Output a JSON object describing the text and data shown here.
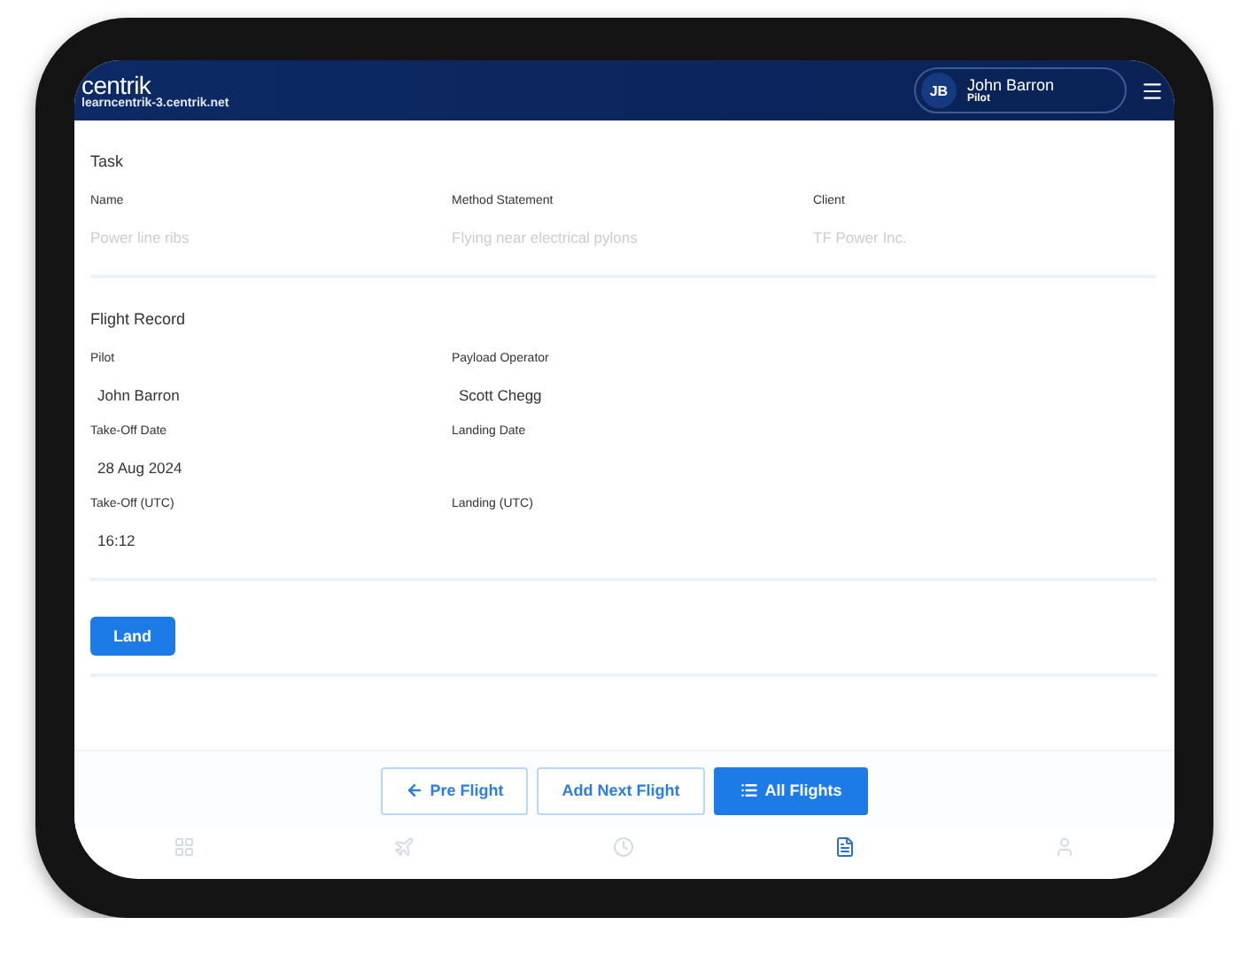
{
  "header": {
    "logo": "centrik",
    "url": "learncentrik-3.centrik.net",
    "user": {
      "initials": "JB",
      "name": "John Barron",
      "role": "Pilot"
    }
  },
  "sections": [
    {
      "title": "Task",
      "rows": [
        [
          {
            "label": "Name",
            "value": "Power line ribs",
            "disabled": true
          },
          {
            "label": "Method Statement",
            "value": "Flying near electrical pylons",
            "disabled": true
          },
          {
            "label": "Client",
            "value": "TF Power Inc.",
            "disabled": true
          }
        ]
      ]
    },
    {
      "title": "Flight Record",
      "rows": [
        [
          {
            "label": "Pilot",
            "value": "John Barron",
            "disabled": false
          },
          {
            "label": "Payload Operator",
            "value": "Scott Chegg",
            "disabled": false
          }
        ],
        [
          {
            "label": "Take-Off Date",
            "value": "28 Aug 2024",
            "disabled": false
          },
          {
            "label": "Landing Date"
          }
        ],
        [
          {
            "label": "Take-Off (UTC)",
            "value": "16:12",
            "disabled": false
          },
          {
            "label": "Landing (UTC)"
          }
        ]
      ]
    }
  ],
  "land_button": "Land",
  "actions": [
    {
      "label": "Pre Flight",
      "kind": "back"
    },
    {
      "label": "Add Next Flight",
      "kind": "outline"
    },
    {
      "label": "All Flights",
      "kind": "primary"
    }
  ],
  "nav": [
    {
      "selected": false
    },
    {
      "selected": false
    },
    {
      "selected": false
    },
    {
      "selected": true
    },
    {
      "selected": false
    }
  ]
}
